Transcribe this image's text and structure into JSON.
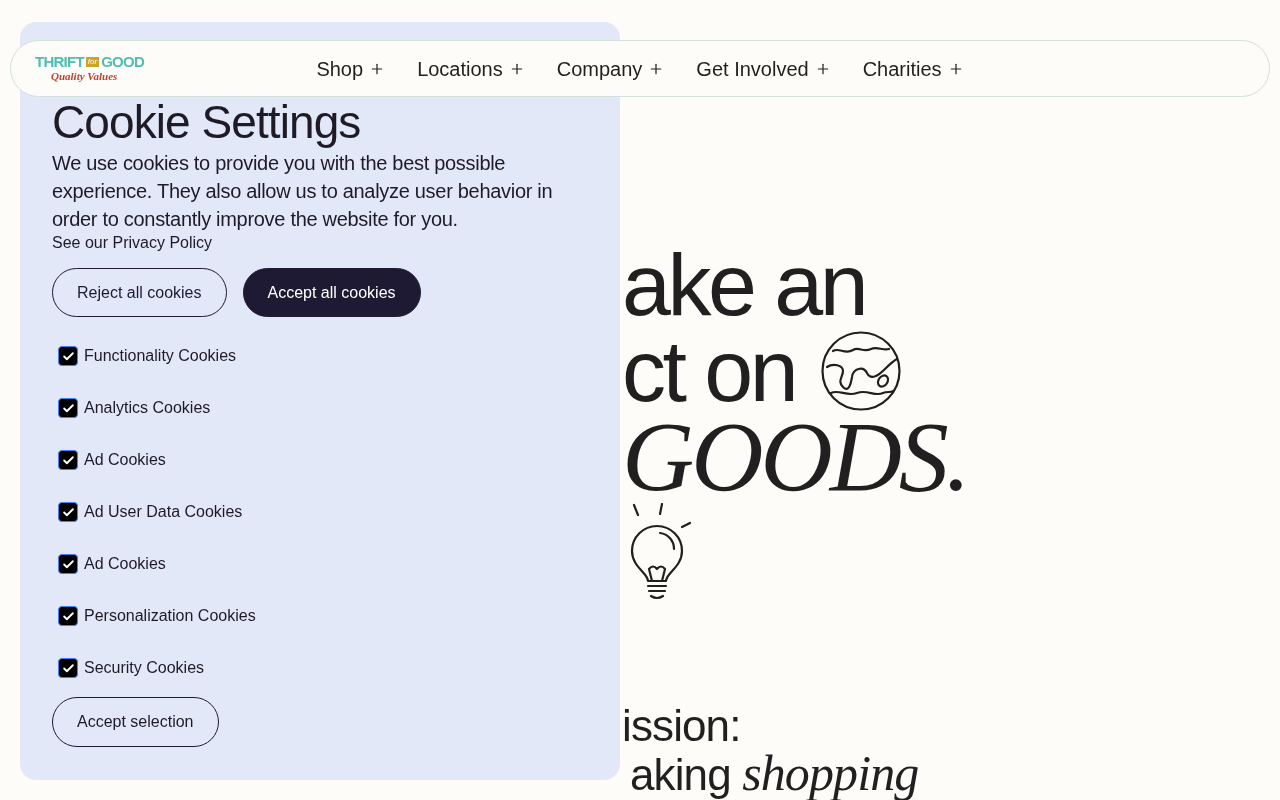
{
  "nav": {
    "logo": {
      "word_1": "THRIFT",
      "badge": "for",
      "word_2": "GOOD",
      "tagline": "Quality Values"
    },
    "items": [
      "Shop",
      "Locations",
      "Company",
      "Get Involved",
      "Charities"
    ]
  },
  "cookie_settings": {
    "title": "Cookie Settings",
    "description": "We use cookies to provide you with the best possible experience. They also allow us to analyze user behavior in order to constantly improve the website for you.",
    "privacy_link": "See our Privacy Policy",
    "buttons": [
      {
        "label": "Reject all cookies",
        "kind": "outline"
      },
      {
        "label": "Accept all cookies",
        "kind": "filled"
      }
    ],
    "options": [
      {
        "label": "Functionality Cookies",
        "checked": true
      },
      {
        "label": "Analytics Cookies",
        "checked": true
      },
      {
        "label": "Ad Cookies",
        "checked": true
      },
      {
        "label": "Ad User Data Cookies",
        "checked": true
      },
      {
        "label": "Ad Cookies",
        "checked": true
      },
      {
        "label": "Personalization Cookies",
        "checked": true
      },
      {
        "label": "Security Cookies",
        "checked": true
      }
    ],
    "submit_button": "Accept selection"
  },
  "hero": {
    "line_1": "ake an",
    "line_2": "ct on",
    "line_3": "GOODS.",
    "mission_heading": "ission:",
    "mission_text": "aking *shopping*"
  }
}
